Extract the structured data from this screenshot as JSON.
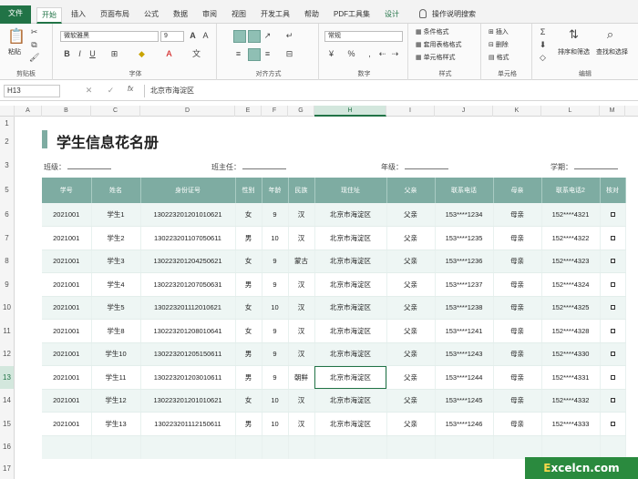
{
  "tabs": [
    "文件",
    "开始",
    "插入",
    "页面布局",
    "公式",
    "数据",
    "审阅",
    "视图",
    "开发工具",
    "帮助",
    "PDF工具集",
    "设计"
  ],
  "search_hint": "操作说明搜索",
  "ribbon": {
    "clipboard": {
      "paste": "粘贴",
      "label": "剪贴板"
    },
    "font": {
      "name": "微软雅黑",
      "size": "9",
      "label": "字体",
      "bold": "B",
      "italic": "I",
      "underline": "U"
    },
    "align": {
      "label": "对齐方式"
    },
    "number": {
      "format": "常规",
      "label": "数字",
      "percent": "%"
    },
    "styles": {
      "cond": "条件格式",
      "table": "套用表格格式",
      "cell": "单元格样式",
      "label": "样式"
    },
    "cells": {
      "insert": "插入",
      "delete": "删除",
      "format": "格式",
      "label": "单元格"
    },
    "edit": {
      "sort": "排序和筛选",
      "find": "查找和选择",
      "label": "编辑"
    }
  },
  "formula_bar": {
    "cell_ref": "H13",
    "fx": "fx",
    "content": "北京市海淀区"
  },
  "columns": [
    "A",
    "B",
    "C",
    "D",
    "E",
    "F",
    "G",
    "H",
    "I",
    "J",
    "K",
    "L",
    "M"
  ],
  "selected_column": "H",
  "rows": [
    "1",
    "2",
    "3",
    "5",
    "6",
    "7",
    "8",
    "9",
    "10",
    "11",
    "12",
    "13",
    "14",
    "15",
    "16",
    "17"
  ],
  "selected_row": "13",
  "sheet": {
    "title": "学生信息花名册",
    "fields": [
      "班级：",
      "班主任：",
      "年级：",
      "学期："
    ],
    "headers": [
      "学号",
      "姓名",
      "身份证号",
      "性别",
      "年龄",
      "民族",
      "现住址",
      "父亲",
      "联系电话",
      "母亲",
      "联系电话2",
      "核对"
    ],
    "records": [
      [
        "2021001",
        "学生1",
        "130223201201010621",
        "女",
        "9",
        "汉",
        "北京市海淀区",
        "父亲",
        "153****1234",
        "母亲",
        "152****4321"
      ],
      [
        "2021001",
        "学生2",
        "130223201107050611",
        "男",
        "10",
        "汉",
        "北京市海淀区",
        "父亲",
        "153****1235",
        "母亲",
        "152****4322"
      ],
      [
        "2021001",
        "学生3",
        "130223201204250621",
        "女",
        "9",
        "蒙古",
        "北京市海淀区",
        "父亲",
        "153****1236",
        "母亲",
        "152****4323"
      ],
      [
        "2021001",
        "学生4",
        "130223201207050631",
        "男",
        "9",
        "汉",
        "北京市海淀区",
        "父亲",
        "153****1237",
        "母亲",
        "152****4324"
      ],
      [
        "2021001",
        "学生5",
        "130223201112010621",
        "女",
        "10",
        "汉",
        "北京市海淀区",
        "父亲",
        "153****1238",
        "母亲",
        "152****4325"
      ],
      [
        "2021001",
        "学生8",
        "130223201208010641",
        "女",
        "9",
        "汉",
        "北京市海淀区",
        "父亲",
        "153****1241",
        "母亲",
        "152****4328"
      ],
      [
        "2021001",
        "学生10",
        "130223201205150611",
        "男",
        "9",
        "汉",
        "北京市海淀区",
        "父亲",
        "153****1243",
        "母亲",
        "152****4330"
      ],
      [
        "2021001",
        "学生11",
        "130223201203010611",
        "男",
        "9",
        "朝鲜",
        "北京市海淀区",
        "父亲",
        "153****1244",
        "母亲",
        "152****4331"
      ],
      [
        "2021001",
        "学生12",
        "130223201201010621",
        "女",
        "10",
        "汉",
        "北京市海淀区",
        "父亲",
        "153****1245",
        "母亲",
        "152****4332"
      ],
      [
        "2021001",
        "学生13",
        "130223201112150611",
        "男",
        "10",
        "汉",
        "北京市海淀区",
        "父亲",
        "153****1246",
        "母亲",
        "152****4333"
      ]
    ]
  },
  "watermark": {
    "e": "E",
    "rest": "xcelcn.com"
  }
}
